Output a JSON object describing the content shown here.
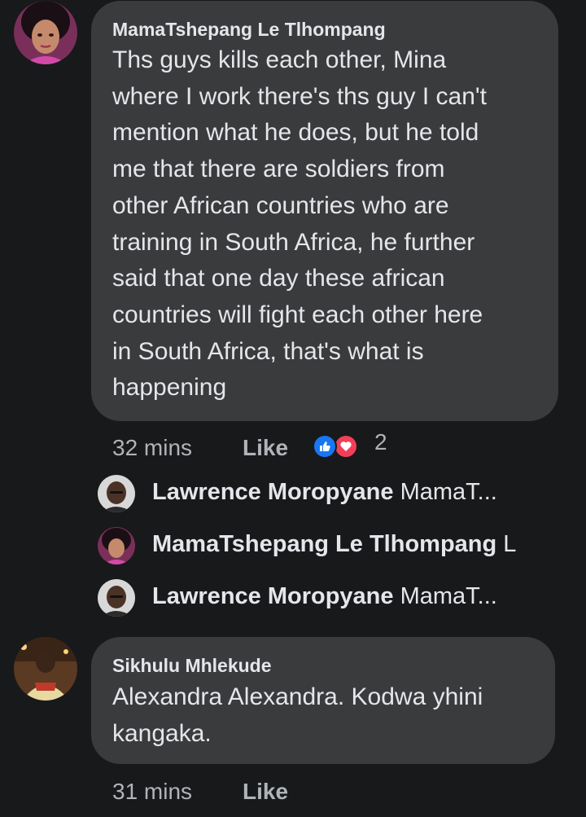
{
  "comments": [
    {
      "author": "MamaTshepang Le Tlhompang",
      "text": "Ths guys kills each other, Mina\nwhere I work there's ths guy I can't\nmention what he does, but he told\nme that there are soldiers from\nother African countries who are\ntraining in South Africa, he further\nsaid that one day these african\ncountries will fight each other here\nin South Africa, that's what is\nhappening",
      "time": "32 mins",
      "like_label": "Like",
      "reaction_count": "2"
    },
    {
      "author": "Sikhulu Mhlekude",
      "text": "Alexandra Alexandra.  Kodwa yhini\nkangaka.",
      "time": "31 mins",
      "like_label": "Like"
    }
  ],
  "replies": [
    {
      "author": "Lawrence Moropyane",
      "preview": "MamaT..."
    },
    {
      "author": "MamaTshepang Le Tlhompang",
      "preview": "L"
    },
    {
      "author": "Lawrence Moropyane",
      "preview": "MamaT..."
    }
  ],
  "colors": {
    "background": "#18191a",
    "bubble": "#3a3b3c",
    "text_primary": "#e4e6eb",
    "text_secondary": "#b0b3b8",
    "like_reaction": "#1877f2",
    "love_reaction": "#f33e58"
  },
  "icons": {
    "like_reaction": "thumbs-up-icon",
    "love_reaction": "heart-icon"
  }
}
